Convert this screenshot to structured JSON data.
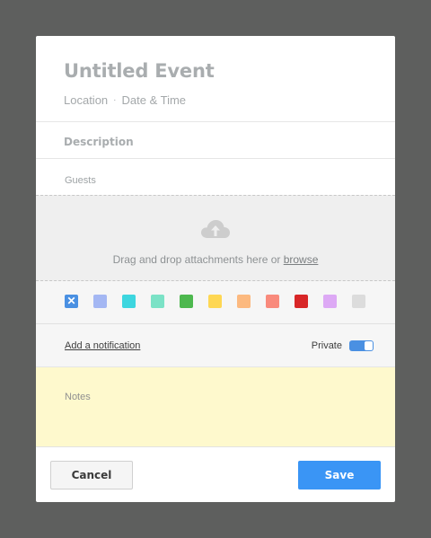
{
  "event": {
    "title": "Untitled Event",
    "location_label": "Location",
    "separator": "·",
    "datetime_label": "Date & Time",
    "description_label": "Description",
    "guests_label": "Guests"
  },
  "attachments": {
    "text_prefix": "Drag and drop attachments here or ",
    "browse_label": "browse",
    "icon": "cloud-upload-icon"
  },
  "colors": {
    "selected_mark": "✕",
    "swatches": [
      "#4a90e2",
      "#a4b7f3",
      "#3dd6df",
      "#7be2c6",
      "#4db84e",
      "#fed753",
      "#fcb97f",
      "#f98a7c",
      "#d82627",
      "#dda9f5",
      "#dcdcdc"
    ]
  },
  "options": {
    "add_notification_label": "Add a notification",
    "private_label": "Private",
    "private_on": true
  },
  "notes": {
    "placeholder": "Notes"
  },
  "footer": {
    "cancel_label": "Cancel",
    "save_label": "Save"
  }
}
